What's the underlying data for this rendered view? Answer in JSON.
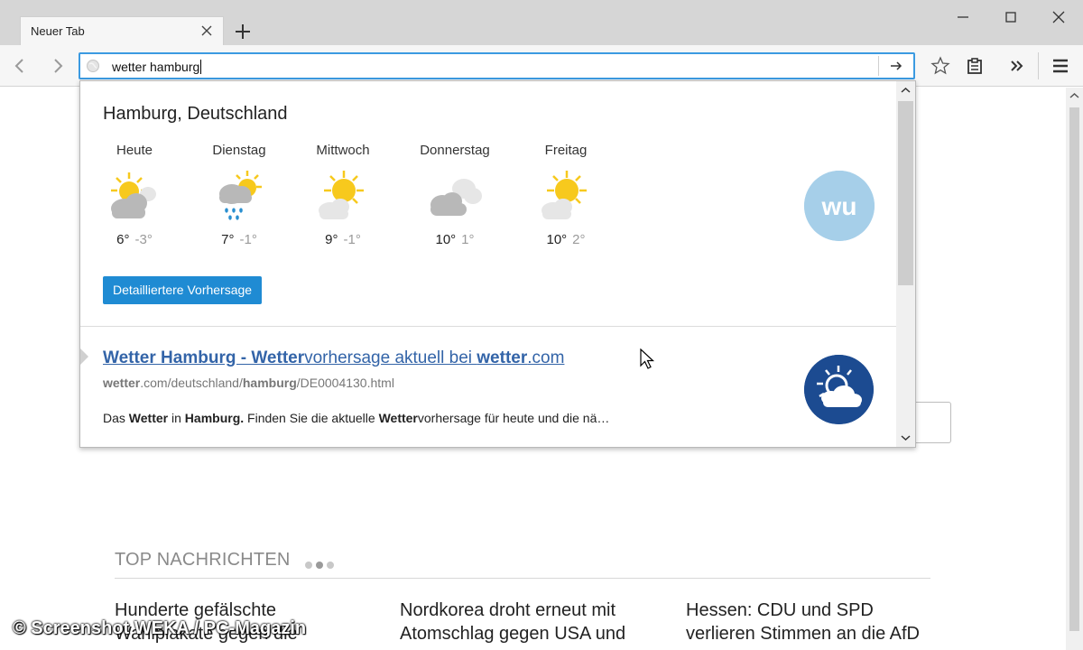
{
  "browser": {
    "tab": {
      "title": "Neuer Tab"
    },
    "urlbar": {
      "value": "wetter hamburg"
    }
  },
  "weather": {
    "city": "Hamburg, Deutschland",
    "days": [
      {
        "name": "Heute",
        "high": "6°",
        "low": "-3°",
        "icon": "sun-cloud-icon"
      },
      {
        "name": "Dienstag",
        "high": "7°",
        "low": "-1°",
        "icon": "sun-cloud-rain-icon"
      },
      {
        "name": "Mittwoch",
        "high": "9°",
        "low": "-1°",
        "icon": "sun-cloud-icon"
      },
      {
        "name": "Donnerstag",
        "high": "10°",
        "low": "1°",
        "icon": "cloudy-icon"
      },
      {
        "name": "Freitag",
        "high": "10°",
        "low": "2°",
        "icon": "sun-cloud-icon"
      }
    ],
    "button_label": "Detailliertere Vorhersage",
    "provider_logo_text": "wu"
  },
  "result": {
    "title_parts": [
      {
        "text": "Wetter Hamburg - Wetter",
        "bold": true
      },
      {
        "text": "vorhersage aktuell bei ",
        "bold": false
      },
      {
        "text": "wetter",
        "bold": true
      },
      {
        "text": ".com",
        "bold": false
      }
    ],
    "url_parts": [
      {
        "text": "wetter",
        "bold": true
      },
      {
        "text": ".com/deutschland/",
        "bold": false
      },
      {
        "text": "hamburg",
        "bold": true
      },
      {
        "text": "/DE0004130.html",
        "bold": false
      }
    ],
    "snippet_parts": [
      {
        "text": "Das ",
        "bold": false
      },
      {
        "text": "Wetter",
        "bold": true
      },
      {
        "text": " in ",
        "bold": false
      },
      {
        "text": "Hamburg.",
        "bold": true
      },
      {
        "text": " Finden Sie die aktuelle ",
        "bold": false
      },
      {
        "text": "Wetter",
        "bold": true
      },
      {
        "text": "vorhersage für heute und die nä…",
        "bold": false
      }
    ]
  },
  "news": {
    "heading": "TOP NACHRICHTEN",
    "items": [
      {
        "text": "Hunderte gefälschte Wahlplakate gegen die"
      },
      {
        "text": "Nordkorea droht erneut mit Atomschlag gegen USA und"
      },
      {
        "text": "Hessen: CDU und SPD verlieren Stimmen an die AfD"
      }
    ]
  },
  "watermark": "© Screenshot WEKA / PC-Magazin",
  "colors": {
    "accent": "#1f8bd3",
    "link": "#3364a8",
    "urlbar_border": "#3b9ae1",
    "sun": "#f7c91d"
  }
}
